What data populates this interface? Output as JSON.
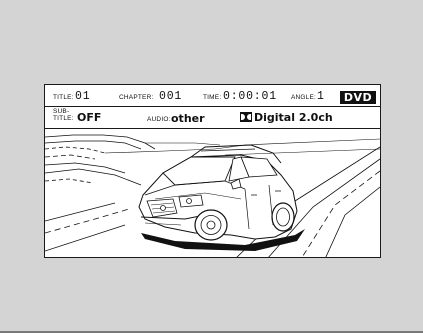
{
  "osd": {
    "title_label": "TITLE:",
    "title_value": "01",
    "chapter_label": "CHAPTER:",
    "chapter_value": "001",
    "time_label": "TIME:",
    "time_value": "0:00:01",
    "angle_label": "ANGLE:",
    "angle_value": "1",
    "disc_badge": "DVD",
    "subtitle_label_line1": "SUB-",
    "subtitle_label_line2": "TITLE:",
    "subtitle_value": "OFF",
    "audio_label": "AUDIO:",
    "audio_value": "other",
    "audio_format": "Digital 2.0ch",
    "audio_format_icon": "dolby-double-d-icon"
  },
  "scene": {
    "image": "suv-driving-on-highway-illustration"
  }
}
